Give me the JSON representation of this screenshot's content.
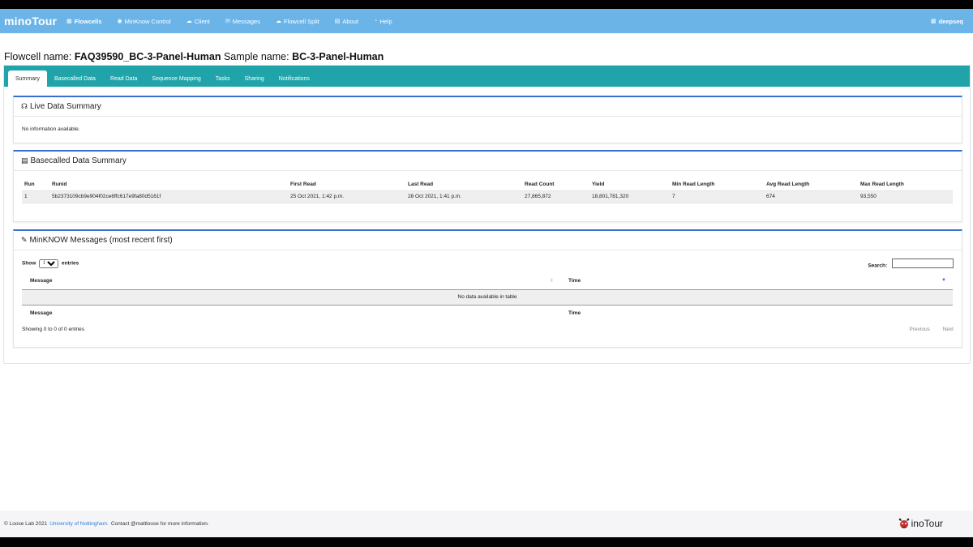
{
  "nav": {
    "brand": "minoTour",
    "items": [
      {
        "icon": "table-icon",
        "glyph": "▦",
        "label": "Flowcells"
      },
      {
        "icon": "eye-icon",
        "glyph": "◉",
        "label": "MinKnow Control"
      },
      {
        "icon": "cloud-icon",
        "glyph": "☁",
        "label": "Client"
      },
      {
        "icon": "envelope-icon",
        "glyph": "✉",
        "label": "Messages"
      },
      {
        "icon": "cloud-icon",
        "glyph": "☁",
        "label": "Flowcell Split"
      },
      {
        "icon": "book-icon",
        "glyph": "▤",
        "label": "About"
      },
      {
        "icon": "gauge-icon",
        "glyph": "◔",
        "label": "Help"
      }
    ],
    "user": "deepseq"
  },
  "heading": {
    "flowcell_prefix": "Flowcell name:",
    "flowcell_name": "FAQ39590_BC-3-Panel-Human",
    "sample_prefix": "Sample name:",
    "sample_name": "BC-3-Panel-Human"
  },
  "tabs": [
    "Summary",
    "Basecalled Data",
    "Read Data",
    "Sequence Mapping",
    "Tasks",
    "Sharing",
    "Notifications"
  ],
  "live_summary": {
    "title": "Live Data Summary",
    "message": "No information available."
  },
  "basecalled_summary": {
    "title": "Basecalled Data Summary",
    "columns": [
      "Run",
      "Runid",
      "First Read",
      "Last Read",
      "Read Count",
      "Yield",
      "Min Read Length",
      "Avg Read Length",
      "Max Read Length"
    ],
    "rows": [
      [
        "1",
        "5b2373109cb9e904f02ce6ffc617e9fa80d5161f",
        "25 Oct 2021, 1:42 p.m.",
        "28 Oct 2021, 1:41 p.m.",
        "27,865,872",
        "18,801,781,320",
        "7",
        "674",
        "93,550"
      ]
    ]
  },
  "messages": {
    "title": "MinKNOW Messages (most recent first)",
    "show_label": "Show",
    "entries_value": "10",
    "entries_label": "entries",
    "search_label": "Search:",
    "col_message": "Message",
    "col_time": "Time",
    "empty": "No data available in table",
    "info": "Showing 0 to 0 of 0 entries",
    "previous": "Previous",
    "next": "Next"
  },
  "footer": {
    "copyright": "© Loose Lab 2021",
    "university": "University of Nottingham.",
    "contact": "Contact @mattloose for more information.",
    "logo_text": "inoTour"
  },
  "colors": {
    "navbar": "#6ab4e8",
    "tabbar": "#20a4a9",
    "card_accent": "#3a6fd0",
    "link": "#2b7ed6"
  }
}
